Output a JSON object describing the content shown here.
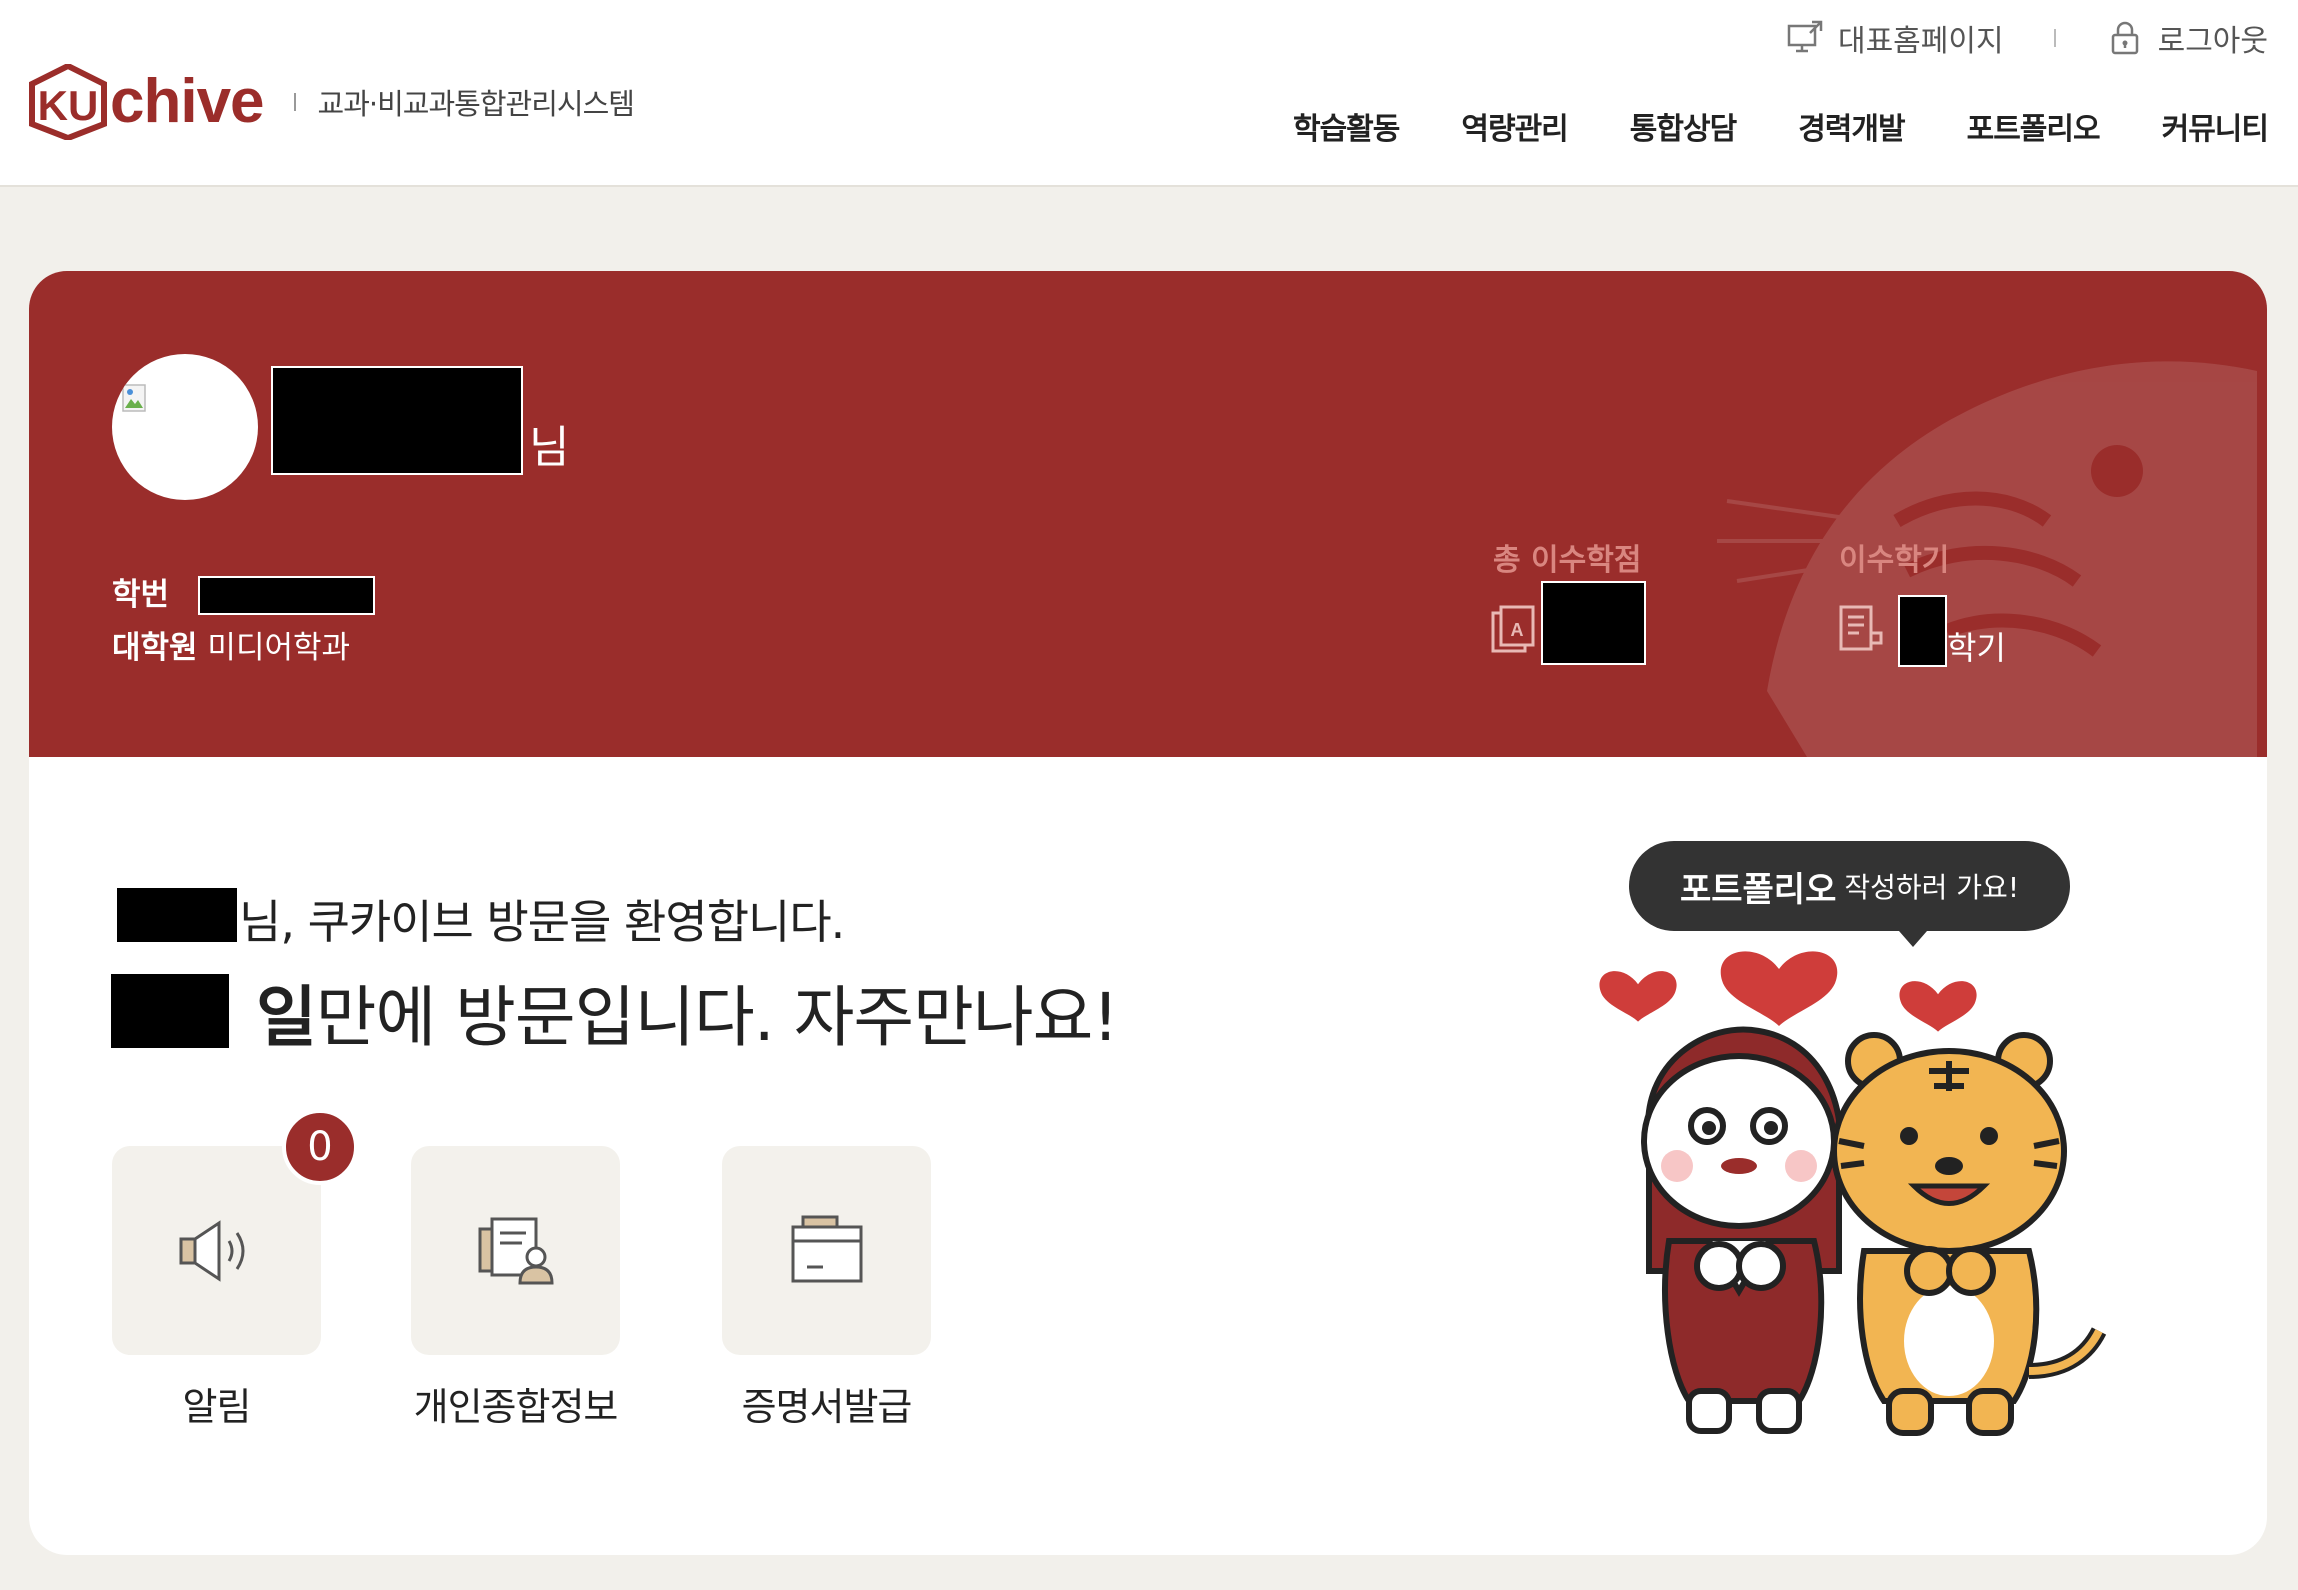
{
  "header": {
    "logo_text": "chive",
    "logo_mark_letters": "KU",
    "system_name": "교과·비교과통합관리시스템",
    "util": {
      "homepage_label": "대표홈페이지",
      "logout_label": "로그아웃"
    },
    "nav": [
      "학습활동",
      "역량관리",
      "통합상담",
      "경력개발",
      "포트폴리오",
      "커뮤니티"
    ]
  },
  "profile": {
    "name_suffix": "님",
    "student_id_label": "학번",
    "division": "대학원",
    "department": "미디어학과",
    "total_credits_label": "총 이수학점",
    "semesters_label": "이수학기",
    "semesters_suffix": "학기"
  },
  "welcome": {
    "line1": "님, 쿠카이브 방문을 환영합니다.",
    "line2_strong": "일",
    "line2_rest": "만에 방문입니다. 자주만나요!"
  },
  "quick_menu": [
    {
      "label": "알림",
      "icon": "speaker-icon",
      "badge": "0"
    },
    {
      "label": "개인종합정보",
      "icon": "personal-info-icon"
    },
    {
      "label": "증명서발급",
      "icon": "folder-icon"
    }
  ],
  "portfolio_bubble": {
    "strong": "포트폴리오",
    "rest": "작성하러 가요!"
  },
  "colors": {
    "brand": "#9a2d2b",
    "background": "#f2f0eb",
    "tile": "#f3f1ec",
    "bubble": "#333333"
  }
}
